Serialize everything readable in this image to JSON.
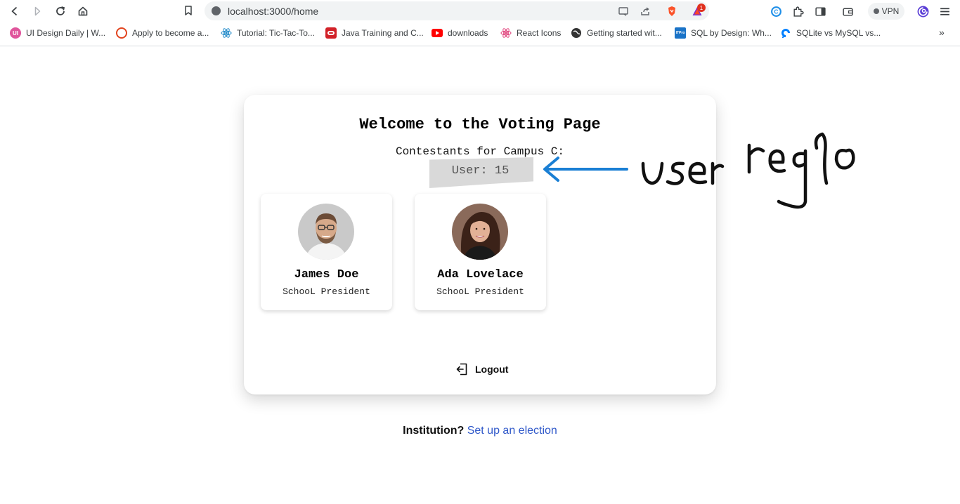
{
  "browser": {
    "url": "localhost:3000/home",
    "vpn_label": "VPN",
    "notification_count": "1",
    "bookmarks": [
      {
        "label": "UI Design Daily | W...",
        "icon": "ui-design-daily-icon",
        "color": "#e0559c",
        "glyph": "UI"
      },
      {
        "label": "Apply to become a...",
        "icon": "smiley-icon",
        "color": "#e2431d",
        "glyph": ""
      },
      {
        "label": "Tutorial: Tic-Tac-To...",
        "icon": "react-icon",
        "color": "#1e88c8",
        "glyph": ""
      },
      {
        "label": "Java Training and C...",
        "icon": "oracle-icon",
        "color": "#d22128",
        "glyph": ""
      },
      {
        "label": "downloads",
        "icon": "youtube-icon",
        "color": "#ff0000",
        "glyph": ""
      },
      {
        "label": "React Icons",
        "icon": "react-icons-icon",
        "color": "#e0437c",
        "glyph": ""
      },
      {
        "label": "Getting started wit...",
        "icon": "globe-icon",
        "color": "#333333",
        "glyph": ""
      },
      {
        "label": "SQL by Design: Wh...",
        "icon": "itpro-icon",
        "color": "#1a73c7",
        "glyph": "ITPro"
      },
      {
        "label": "SQLite vs MySQL vs...",
        "icon": "digitalocean-icon",
        "color": "#0080ff",
        "glyph": ""
      }
    ],
    "more_bookmarks": "»"
  },
  "page": {
    "title": "Welcome to the Voting Page",
    "subtitle": "Contestants for Campus C:",
    "user_label": "User: 15",
    "contestants": [
      {
        "name": "James Doe",
        "role": "SchooL President"
      },
      {
        "name": "Ada Lovelace",
        "role": "SchooL President"
      }
    ],
    "logout_label": "Logout",
    "footer_lead": "Institution?",
    "footer_link": "Set up an election"
  },
  "annotation": {
    "text": "user regno",
    "arrow_color": "#1a7fd4"
  }
}
